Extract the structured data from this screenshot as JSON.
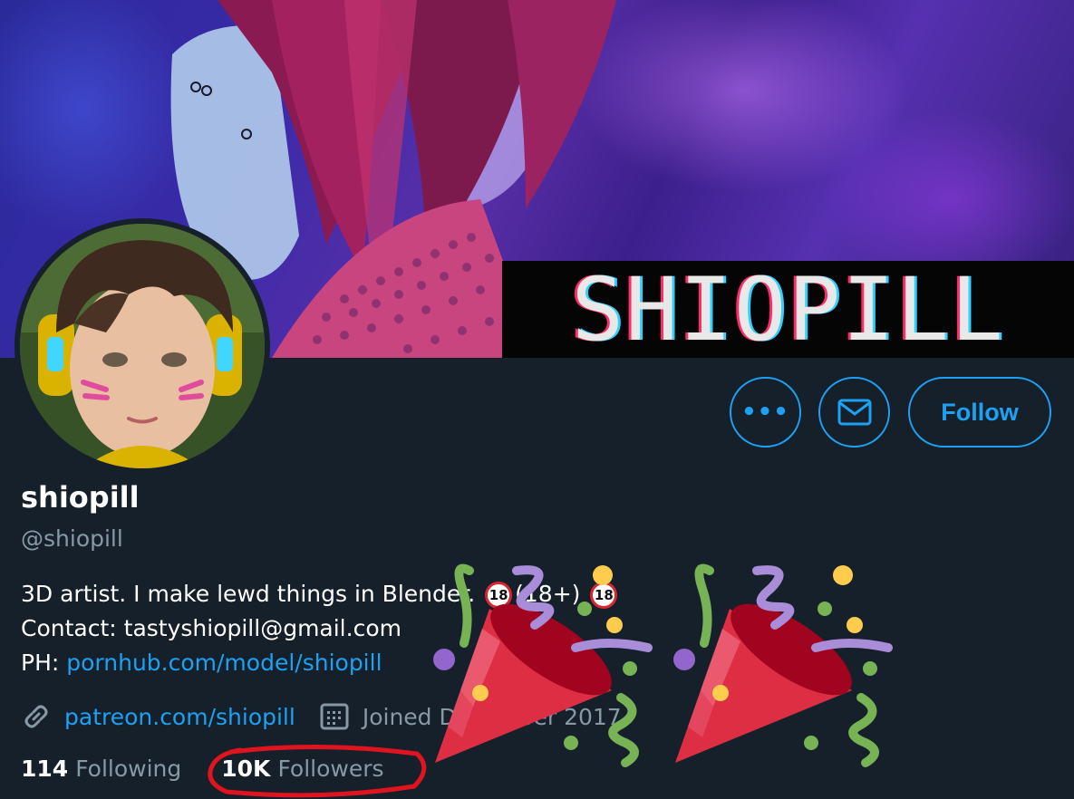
{
  "banner": {
    "overlay_text": "SHIOPILL"
  },
  "profile": {
    "display_name": "shiopill",
    "handle": "@shiopill",
    "bio_line1_text": "3D artist. I make lewd things in Blender.",
    "bio_badge": "18",
    "bio_plus": "(18+)",
    "bio_line2": "Contact: tastyshiopill@gmail.com",
    "bio_line3_prefix": "PH:",
    "bio_line3_link": "pornhub.com/model/shiopill",
    "website": "patreon.com/shiopill",
    "joined": "Joined December 2017",
    "link_icon": "link-icon",
    "calendar_icon": "calendar-icon"
  },
  "stats": {
    "following_count": "114",
    "following_label": "Following",
    "followers_count": "10K",
    "followers_label": "Followers"
  },
  "actions": {
    "more_label": "•••",
    "message_icon": "envelope-icon",
    "follow_label": "Follow"
  },
  "colors": {
    "background": "#15202b",
    "accent": "#1da1f2",
    "secondary_text": "#8899a6",
    "annotation_red": "#e0141e"
  },
  "decorations": [
    "party-popper-emoji",
    "party-popper-emoji"
  ]
}
